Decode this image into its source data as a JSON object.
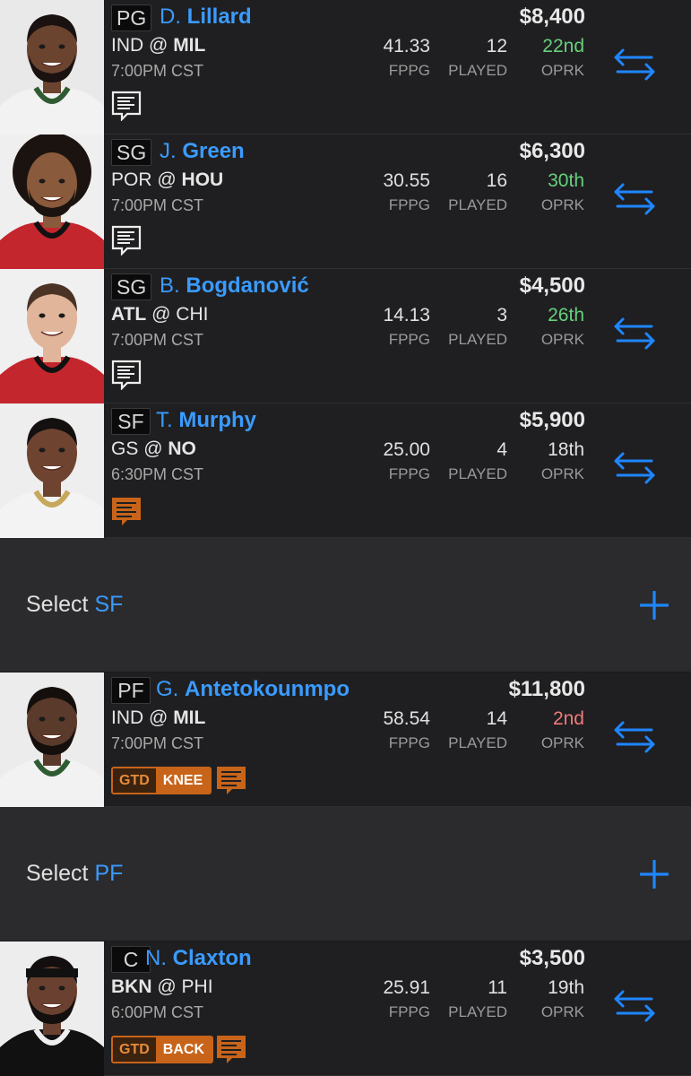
{
  "players": [
    {
      "pos": "PG",
      "initial": "D.",
      "last": "Lillard",
      "salary": "$8,400",
      "away": "IND",
      "home": "MIL",
      "bold_team": "home",
      "time": "7:00PM CST",
      "fppg": "41.33",
      "played": "12",
      "oprk": "22nd",
      "oprk_color": "#66d17c",
      "note_style": "plain",
      "status": null
    },
    {
      "pos": "SG",
      "initial": "J.",
      "last": "Green",
      "salary": "$6,300",
      "away": "POR",
      "home": "HOU",
      "bold_team": "home",
      "time": "7:00PM CST",
      "fppg": "30.55",
      "played": "16",
      "oprk": "30th",
      "oprk_color": "#66d17c",
      "note_style": "plain",
      "status": null
    },
    {
      "pos": "SG",
      "initial": "B.",
      "last": "Bogdanović",
      "salary": "$4,500",
      "away": "ATL",
      "home": "CHI",
      "bold_team": "away",
      "time": "7:00PM CST",
      "fppg": "14.13",
      "played": "3",
      "oprk": "26th",
      "oprk_color": "#66d17c",
      "note_style": "plain",
      "status": null
    },
    {
      "pos": "SF",
      "initial": "T.",
      "last": "Murphy",
      "salary": "$5,900",
      "away": "GS",
      "home": "NO",
      "bold_team": "home",
      "time": "6:30PM CST",
      "fppg": "25.00",
      "played": "4",
      "oprk": "18th",
      "oprk_color": "#e0e0e0",
      "note_style": "orange",
      "status": null
    },
    {
      "pos": "PF",
      "initial": "G.",
      "last": "Antetokounmpo",
      "salary": "$11,800",
      "away": "IND",
      "home": "MIL",
      "bold_team": "home",
      "time": "7:00PM CST",
      "fppg": "58.54",
      "played": "14",
      "oprk": "2nd",
      "oprk_color": "#f07a7a",
      "note_style": "orange",
      "status": {
        "code": "GTD",
        "injury": "KNEE"
      }
    },
    {
      "pos": "C",
      "initial": "N.",
      "last": "Claxton",
      "salary": "$3,500",
      "away": "BKN",
      "home": "PHI",
      "bold_team": "away",
      "time": "6:00PM CST",
      "fppg": "25.91",
      "played": "11",
      "oprk": "19th",
      "oprk_color": "#e0e0e0",
      "note_style": "orange",
      "status": {
        "code": "GTD",
        "injury": "BACK"
      }
    }
  ],
  "select_slots": [
    {
      "prefix": "Select",
      "pos": "SF"
    },
    {
      "prefix": "Select",
      "pos": "PF"
    }
  ],
  "labels": {
    "at": "@",
    "fppg": "FPPG",
    "played": "PLAYED",
    "oprk": "OPRK"
  },
  "icons": {
    "swap": "swap-arrows-icon",
    "note": "news-note-icon",
    "add": "plus-icon"
  },
  "colors": {
    "accent": "#3a9bff",
    "injury": "#c8641a",
    "good_matchup": "#66d17c",
    "bad_matchup": "#f07a7a"
  }
}
